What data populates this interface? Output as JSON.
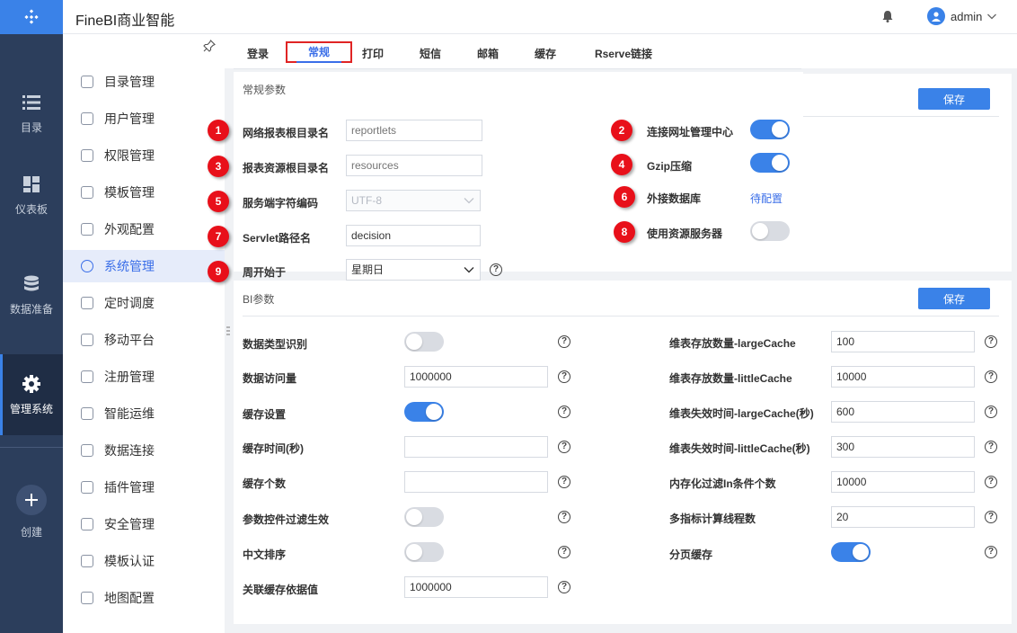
{
  "app": {
    "title": "FineBI商业智能",
    "username": "admin"
  },
  "leftnav": [
    {
      "label": "目录",
      "icon": "list-icon"
    },
    {
      "label": "仪表板",
      "icon": "dashboard-icon"
    },
    {
      "label": "数据准备",
      "icon": "database-icon"
    },
    {
      "label": "管理系统",
      "icon": "gear-icon"
    },
    {
      "label": "创建",
      "icon": "plus-icon"
    }
  ],
  "sidebar": [
    "目录管理",
    "用户管理",
    "权限管理",
    "模板管理",
    "外观配置",
    "系统管理",
    "定时调度",
    "移动平台",
    "注册管理",
    "智能运维",
    "数据连接",
    "插件管理",
    "安全管理",
    "模板认证",
    "地图配置"
  ],
  "tabs": [
    "登录",
    "常规",
    "打印",
    "短信",
    "邮箱",
    "缓存",
    "Rserve链接"
  ],
  "general": {
    "title": "常规参数",
    "save": "保存",
    "report_root": {
      "label": "网络报表根目录名",
      "placeholder": "reportlets"
    },
    "resource_root": {
      "label": "报表资源根目录名",
      "placeholder": "resources"
    },
    "charset": {
      "label": "服务端字符编码",
      "value": "UTF-8"
    },
    "servlet": {
      "label": "Servlet路径名",
      "value": "decision"
    },
    "week_start": {
      "label": "周开始于",
      "value": "星期日"
    },
    "connect_center": {
      "label": "连接网址管理中心",
      "on": true
    },
    "gzip": {
      "label": "Gzip压缩",
      "on": true
    },
    "external_db": {
      "label": "外接数据库",
      "link": "待配置"
    },
    "resource_server": {
      "label": "使用资源服务器",
      "on": false
    },
    "badges": [
      "1",
      "2",
      "3",
      "4",
      "5",
      "6",
      "7",
      "8",
      "9"
    ]
  },
  "bi": {
    "title": "BI参数",
    "save": "保存",
    "left": [
      {
        "label": "数据类型识别",
        "type": "toggle",
        "on": false
      },
      {
        "label": "数据访问量",
        "type": "input",
        "value": "1000000"
      },
      {
        "label": "缓存设置",
        "type": "toggle",
        "on": true
      },
      {
        "label": "缓存时间(秒)",
        "type": "input",
        "value": ""
      },
      {
        "label": "缓存个数",
        "type": "input",
        "value": ""
      },
      {
        "label": "参数控件过滤生效",
        "type": "toggle",
        "on": false
      },
      {
        "label": "中文排序",
        "type": "toggle",
        "on": false
      },
      {
        "label": "关联缓存依据值",
        "type": "input",
        "value": "1000000"
      }
    ],
    "right": [
      {
        "label": "维表存放数量-largeCache",
        "type": "input",
        "value": "100"
      },
      {
        "label": "维表存放数量-littleCache",
        "type": "input",
        "value": "10000"
      },
      {
        "label": "维表失效时间-largeCache(秒)",
        "type": "input",
        "value": "600"
      },
      {
        "label": "维表失效时间-littleCache(秒)",
        "type": "input",
        "value": "300"
      },
      {
        "label": "内存化过滤In条件个数",
        "type": "input",
        "value": "10000"
      },
      {
        "label": "多指标计算线程数",
        "type": "input",
        "value": "20"
      },
      {
        "label": "分页缓存",
        "type": "toggle",
        "on": true
      }
    ]
  },
  "colors": {
    "accent": "#3a82e8",
    "nav": "#2c3e5c",
    "badge": "#e8101a"
  }
}
